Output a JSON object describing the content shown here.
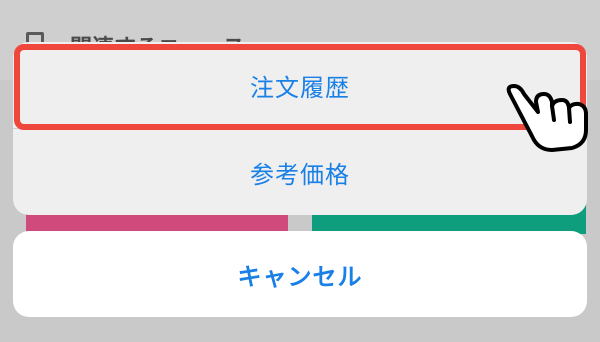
{
  "background": {
    "related_news_label": "関連するニュース"
  },
  "action_sheet": {
    "items": [
      {
        "label": "注文履歴"
      },
      {
        "label": "参考価格"
      }
    ],
    "cancel_label": "キャンセル"
  },
  "colors": {
    "action_text": "#1a80e6",
    "highlight_border": "#f0473c",
    "bg_button_left": "#d04a7b",
    "bg_button_right": "#0f9e7d"
  },
  "icons": {
    "pointer": "tap-hand-icon",
    "news": "document-icon"
  }
}
